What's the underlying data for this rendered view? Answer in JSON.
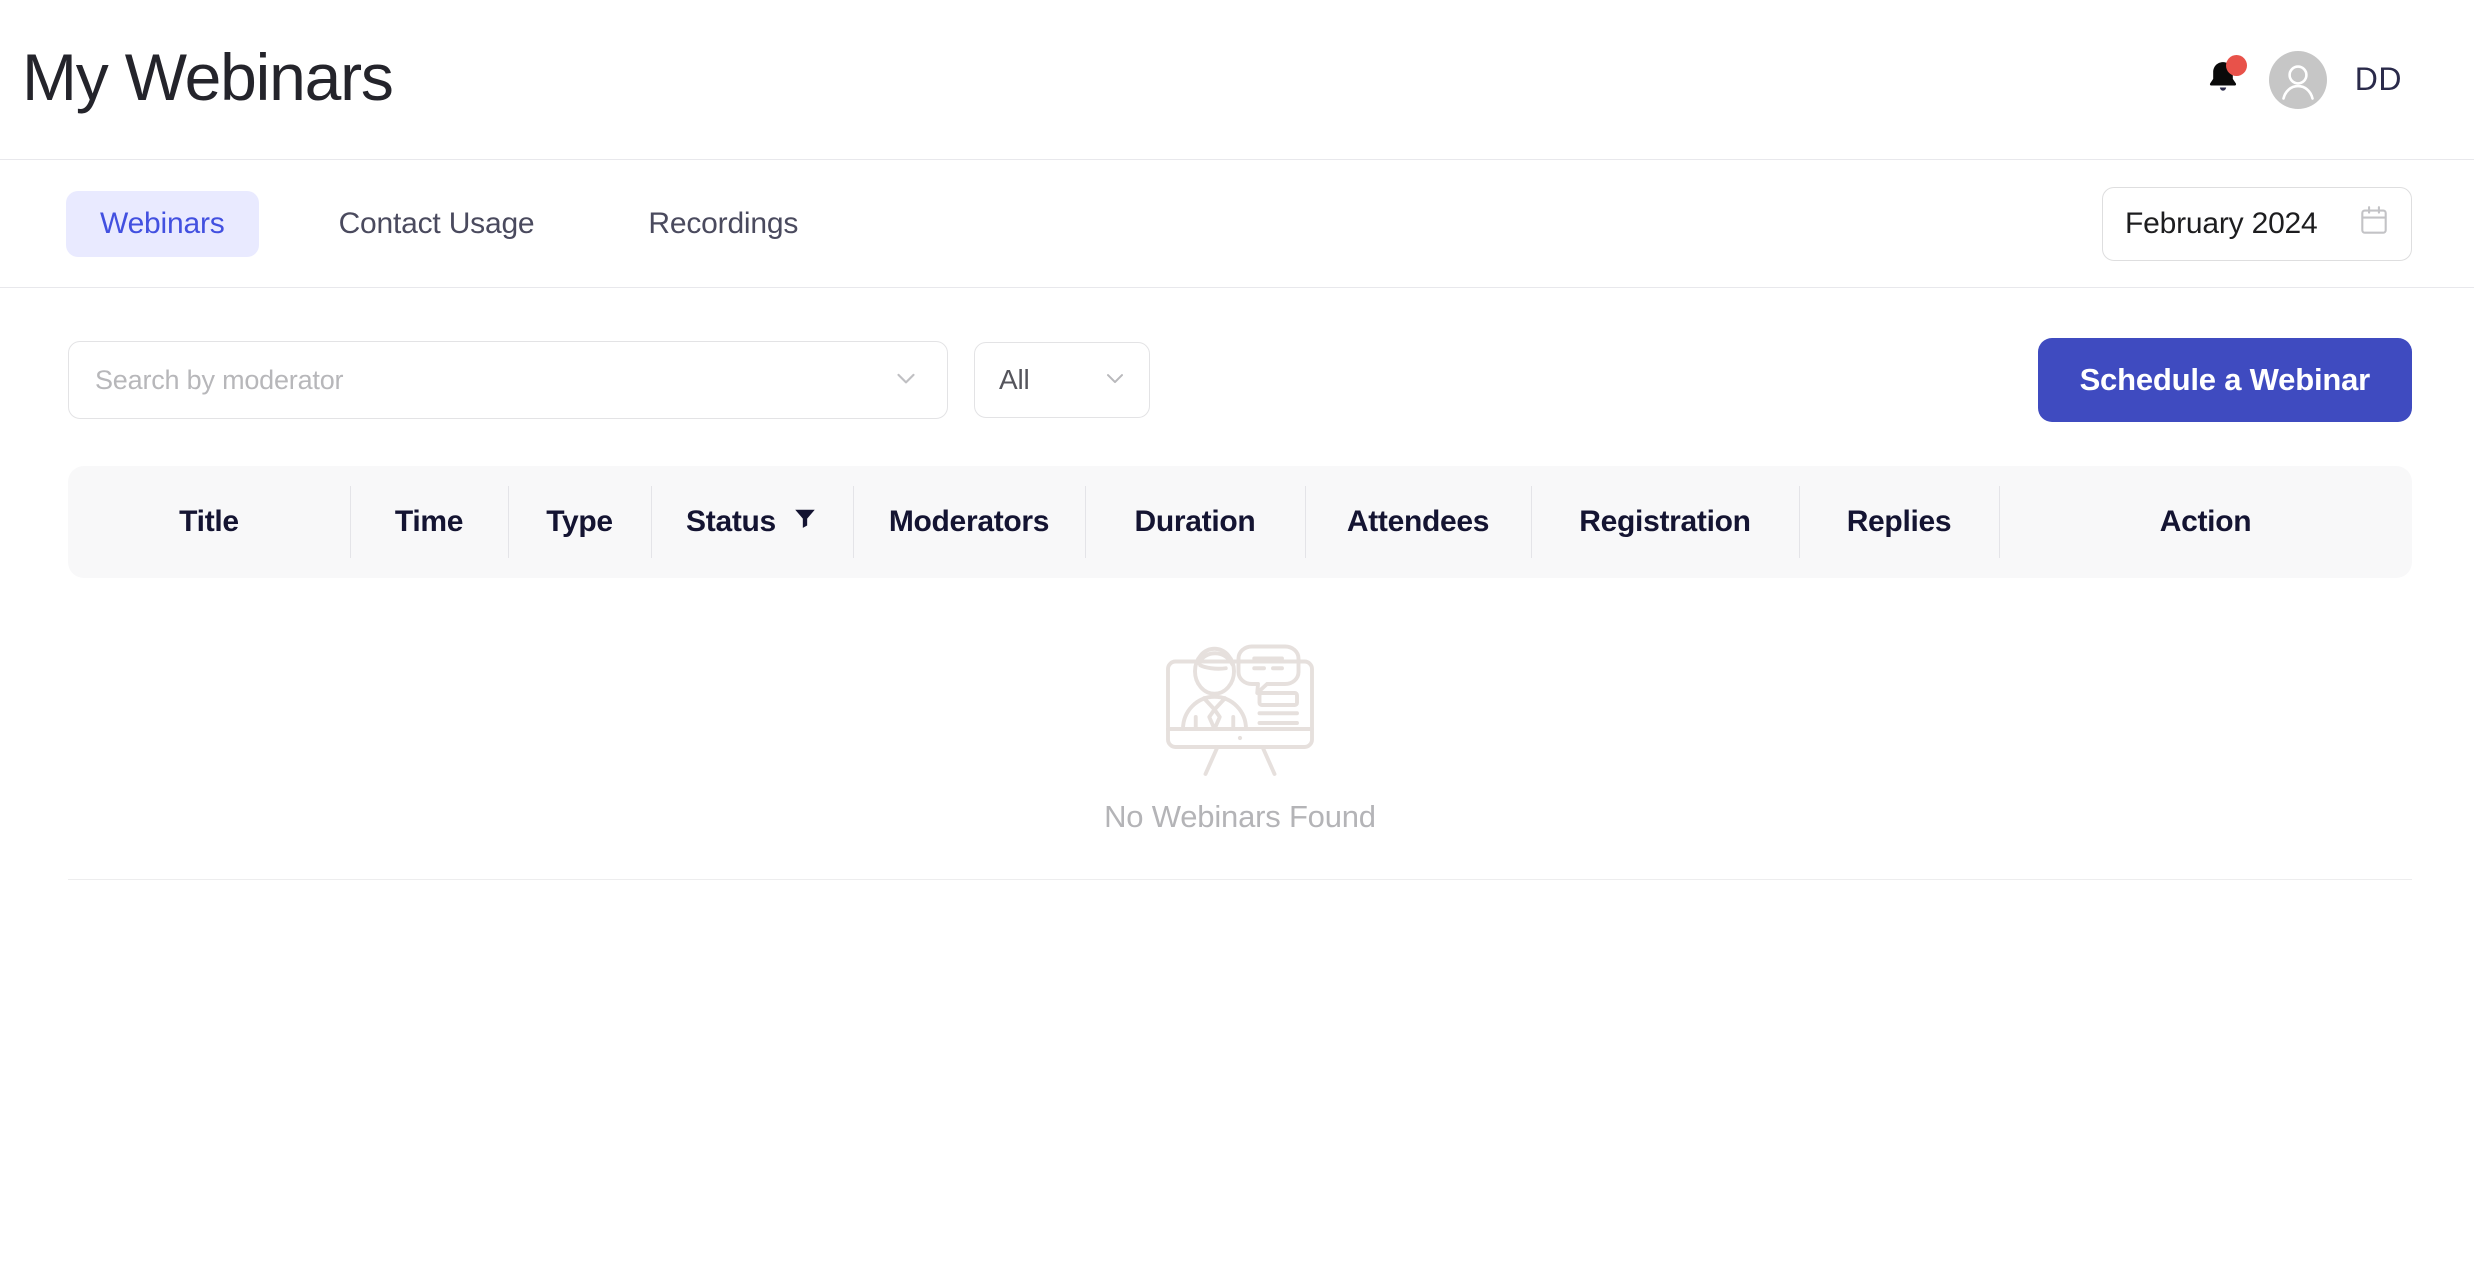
{
  "header": {
    "title": "My Webinars",
    "notification_icon": "bell-icon",
    "notification_badge_color": "#e8524a",
    "avatar_icon": "user-icon",
    "avatar_initials": "DD"
  },
  "tabbar": {
    "tabs": [
      {
        "label": "Webinars",
        "active": true
      },
      {
        "label": "Contact Usage",
        "active": false
      },
      {
        "label": "Recordings",
        "active": false
      }
    ],
    "active_tab_bg": "#e9eaff",
    "active_tab_color": "#4250e0",
    "datepicker": {
      "value": "February 2024",
      "icon": "calendar-icon"
    }
  },
  "filters": {
    "search": {
      "placeholder": "Search by moderator",
      "value": "",
      "icon": "chevron-down-icon"
    },
    "type_select": {
      "value": "All",
      "icon": "chevron-down-icon"
    },
    "schedule_button": {
      "label": "Schedule a Webinar",
      "color": "#3f4bc0"
    }
  },
  "table": {
    "columns": [
      {
        "label": "Title"
      },
      {
        "label": "Time"
      },
      {
        "label": "Type"
      },
      {
        "label": "Status",
        "icon": "filter-icon"
      },
      {
        "label": "Moderators"
      },
      {
        "label": "Duration"
      },
      {
        "label": "Attendees"
      },
      {
        "label": "Registration"
      },
      {
        "label": "Replies"
      },
      {
        "label": "Action"
      }
    ],
    "rows": [],
    "empty_state": {
      "icon": "webinar-presentation-icon",
      "message": "No Webinars Found"
    }
  }
}
